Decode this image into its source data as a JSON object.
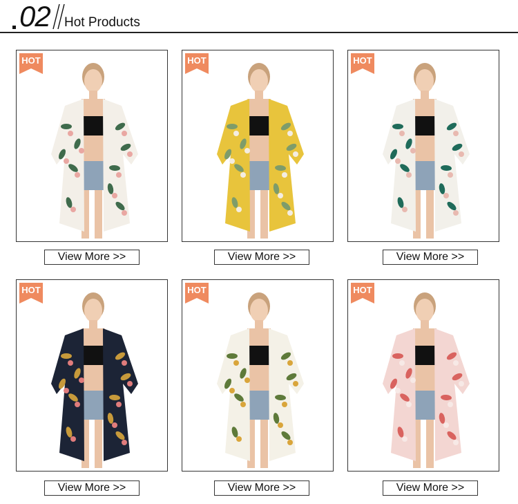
{
  "header": {
    "number": "02",
    "title": "Hot Products"
  },
  "colors": {
    "hot_badge": "#ef8a5f",
    "frame": "#333333"
  },
  "products": [
    {
      "badge": "HOT",
      "button": "View More >>",
      "pattern": "white floral",
      "base": "#f3efe8",
      "leaf": "#3f6b4c",
      "flower": "#e9a7a2"
    },
    {
      "badge": "HOT",
      "button": "View More >>",
      "pattern": "yellow floral",
      "base": "#e8c43c",
      "leaf": "#7e9c6a",
      "flower": "#f4ede2"
    },
    {
      "badge": "HOT",
      "button": "View More >>",
      "pattern": "green leaf",
      "base": "#f2f0ea",
      "leaf": "#1f6b5a",
      "flower": "#e8b9b0"
    },
    {
      "badge": "HOT",
      "button": "View More >>",
      "pattern": "navy floral",
      "base": "#1c2436",
      "leaf": "#c79a3b",
      "flower": "#e07c7c"
    },
    {
      "badge": "HOT",
      "button": "View More >>",
      "pattern": "palm print",
      "base": "#f4f1e7",
      "leaf": "#5e7a3a",
      "flower": "#d9a53b"
    },
    {
      "badge": "HOT",
      "button": "View More >>",
      "pattern": "red tie-dye",
      "base": "#f3d6d2",
      "leaf": "#d9635f",
      "flower": "#f7e9e6"
    }
  ]
}
